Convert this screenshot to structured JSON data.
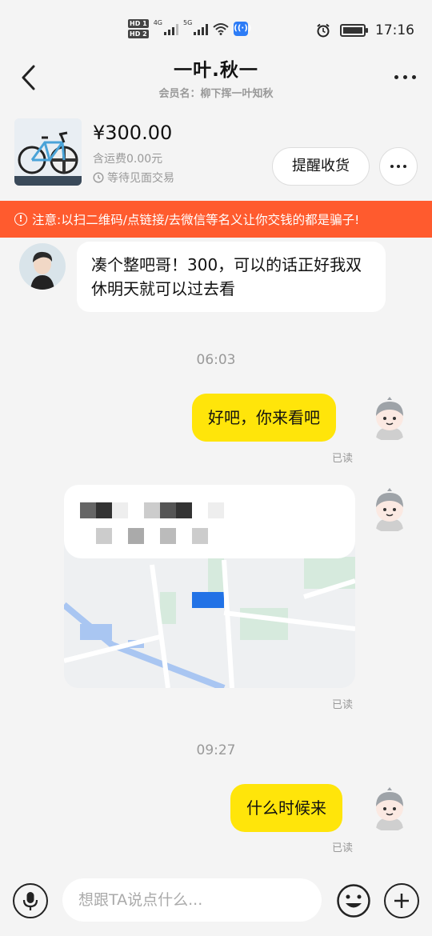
{
  "status_bar": {
    "hd1": "HD 1",
    "hd2": "HD 2",
    "net1": "4G",
    "net2": "5G",
    "time": "17:16"
  },
  "header": {
    "title": "一叶.秋一",
    "member_label": "会员名：柳下挥一叶知秋"
  },
  "product": {
    "price": "¥300.00",
    "shipping": "含运费0.00元",
    "deal_status": "等待见面交易",
    "remind_button": "提醒收货"
  },
  "warning": {
    "text": "注意:以扫二维码/点链接/去微信等名义让你交钱的都是骗子!"
  },
  "messages": [
    {
      "direction": "in",
      "text": "凑个整吧哥！300，可以的话正好我双休明天就可以过去看"
    },
    {
      "direction": "timestamp",
      "text": "06:03"
    },
    {
      "direction": "out",
      "text": "好吧，你来看吧",
      "status": "已读"
    },
    {
      "direction": "out",
      "type": "location",
      "status": "已读"
    },
    {
      "direction": "timestamp",
      "text": "09:27"
    },
    {
      "direction": "out",
      "text": "什么时候来",
      "status": "已读"
    }
  ],
  "input": {
    "placeholder": "想跟TA说点什么..."
  },
  "icons": {
    "back": "chevron-left-icon",
    "more": "more-horizontal-icon",
    "mic": "microphone-icon",
    "emoji": "emoji-smile-icon",
    "plus": "plus-circle-icon",
    "clock": "clock-icon",
    "warning": "alert-circle-icon"
  },
  "colors": {
    "accent_yellow": "#ffe50a",
    "warning_orange": "#ff5b2e",
    "background": "#f4f4f4"
  }
}
